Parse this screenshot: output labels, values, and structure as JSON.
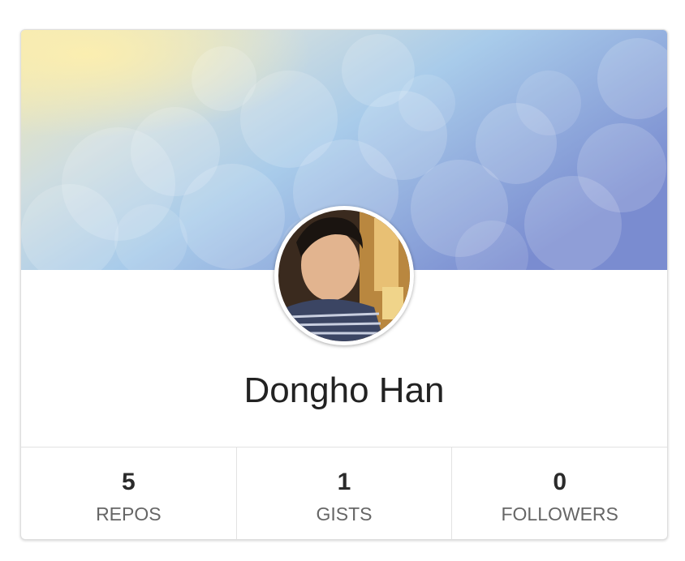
{
  "profile": {
    "name": "Dongho Han",
    "avatar_icon": "user-photo-avatar"
  },
  "stats": [
    {
      "count": "5",
      "label": "REPOS"
    },
    {
      "count": "1",
      "label": "GISTS"
    },
    {
      "count": "0",
      "label": "FOLLOWERS"
    }
  ],
  "colors": {
    "banner_warm": "#f5e9a8",
    "banner_mid": "#a9cde9",
    "banner_cool": "#7b8fd1",
    "text_primary": "#222222",
    "text_muted": "#666666",
    "divider": "#e2e2e2"
  }
}
